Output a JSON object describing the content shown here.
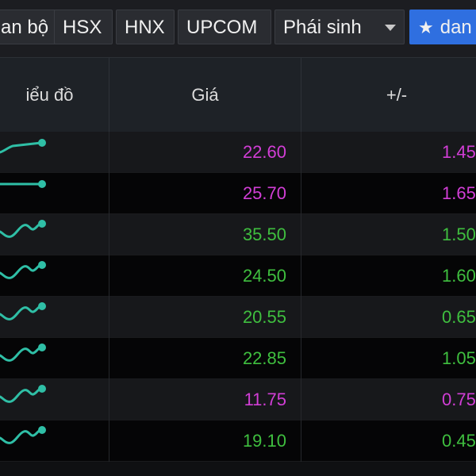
{
  "tabs": [
    {
      "label": "an bộ",
      "dropdown": false
    },
    {
      "label": "HSX",
      "dropdown": false
    },
    {
      "label": "HNX",
      "dropdown": false
    },
    {
      "label": "UPCOM",
      "dropdown": false
    },
    {
      "label": "Phái sinh",
      "dropdown": true
    },
    {
      "label": "dan",
      "icon": "star-icon",
      "active": true
    }
  ],
  "columns": {
    "chart": "iểu đồ",
    "price": "Giá",
    "change": "+/-"
  },
  "colors": {
    "up_pink": "#d23ed6",
    "up_green": "#3fbf3f",
    "spark": "#2fbfa6",
    "active_tab": "#2f6fe0"
  },
  "rows": [
    {
      "price": "22.60",
      "change": "1.45",
      "color": "pink",
      "spark": "rise-flat"
    },
    {
      "price": "25.70",
      "change": "1.65",
      "color": "pink",
      "spark": "flat"
    },
    {
      "price": "35.50",
      "change": "1.50",
      "color": "green",
      "spark": "wave-up"
    },
    {
      "price": "24.50",
      "change": "1.60",
      "color": "green",
      "spark": "wave-up"
    },
    {
      "price": "20.55",
      "change": "0.65",
      "color": "green",
      "spark": "wave-up"
    },
    {
      "price": "22.85",
      "change": "1.05",
      "color": "green",
      "spark": "wave-up"
    },
    {
      "price": "11.75",
      "change": "0.75",
      "color": "pink",
      "spark": "wave-up"
    },
    {
      "price": "19.10",
      "change": "0.45",
      "color": "green",
      "spark": "wave-up"
    }
  ]
}
